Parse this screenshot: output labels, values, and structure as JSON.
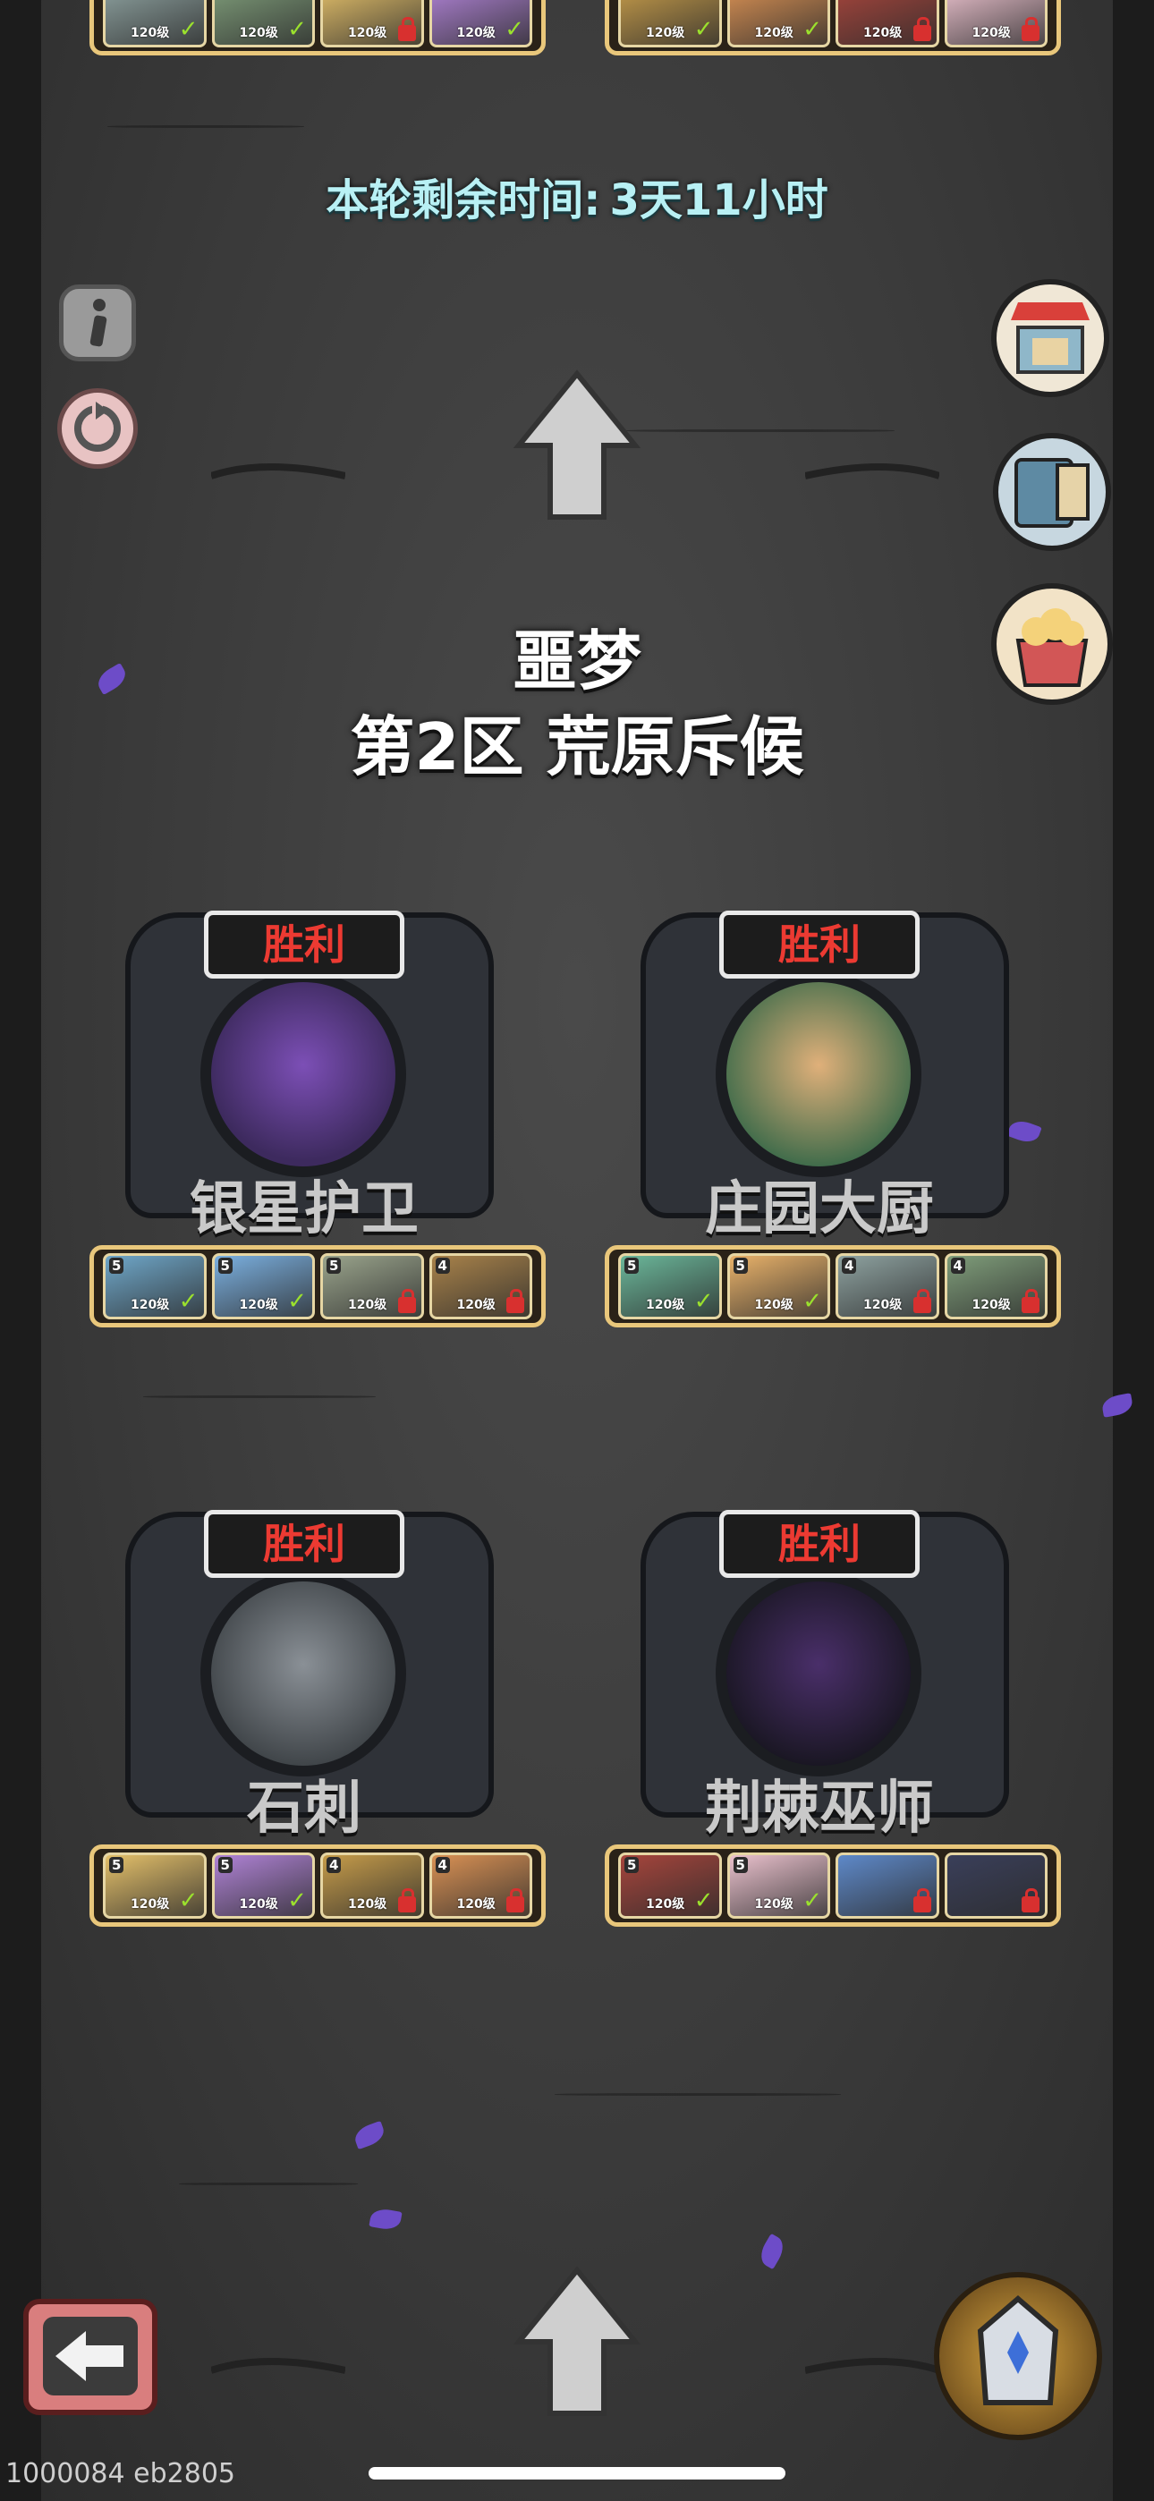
{
  "timer": {
    "label": "本轮剩余时间:",
    "value": "3天11小时"
  },
  "stage": {
    "difficulty": "噩梦",
    "zone": "第2区 荒原斥候"
  },
  "bosses": [
    {
      "name": "银星护卫",
      "status": "胜利",
      "team": [
        {
          "stars": "5",
          "level": "120级",
          "state": "check"
        },
        {
          "stars": "5",
          "level": "120级",
          "state": "check"
        },
        {
          "stars": "5",
          "level": "120级",
          "state": "lock"
        },
        {
          "stars": "4",
          "level": "120级",
          "state": "lock"
        }
      ]
    },
    {
      "name": "庄园大厨",
      "status": "胜利",
      "team": [
        {
          "stars": "5",
          "level": "120级",
          "state": "check"
        },
        {
          "stars": "5",
          "level": "120级",
          "state": "check"
        },
        {
          "stars": "4",
          "level": "120级",
          "state": "lock"
        },
        {
          "stars": "4",
          "level": "120级",
          "state": "lock"
        }
      ]
    },
    {
      "name": "石刺",
      "status": "胜利",
      "team": [
        {
          "stars": "5",
          "level": "120级",
          "state": "check"
        },
        {
          "stars": "5",
          "level": "120级",
          "state": "check"
        },
        {
          "stars": "4",
          "level": "120级",
          "state": "lock"
        },
        {
          "stars": "4",
          "level": "120级",
          "state": "lock"
        }
      ]
    },
    {
      "name": "荆棘巫师",
      "status": "胜利",
      "team": [
        {
          "stars": "5",
          "level": "120级",
          "state": "check"
        },
        {
          "stars": "5",
          "level": "120级",
          "state": "check"
        },
        {
          "stars": "",
          "level": "",
          "state": "lock"
        },
        {
          "stars": "",
          "level": "",
          "state": "lock"
        }
      ]
    }
  ],
  "top_strips": [
    {
      "team": [
        {
          "level": "120级",
          "state": "check"
        },
        {
          "level": "120级",
          "state": "check"
        },
        {
          "level": "120级",
          "state": "lock"
        },
        {
          "level": "120级",
          "state": "check"
        }
      ]
    },
    {
      "team": [
        {
          "level": "120级",
          "state": "check"
        },
        {
          "level": "120级",
          "state": "check"
        },
        {
          "level": "120级",
          "state": "lock"
        },
        {
          "level": "120级",
          "state": "lock"
        }
      ]
    }
  ],
  "debug_text": "1000084 eb2805",
  "colors": {
    "victory_text": "#ec3a32",
    "timer_text": "#b8f0f4",
    "strip_border": "#e9c77b",
    "check": "#9be12d",
    "lock": "#d8302f"
  }
}
